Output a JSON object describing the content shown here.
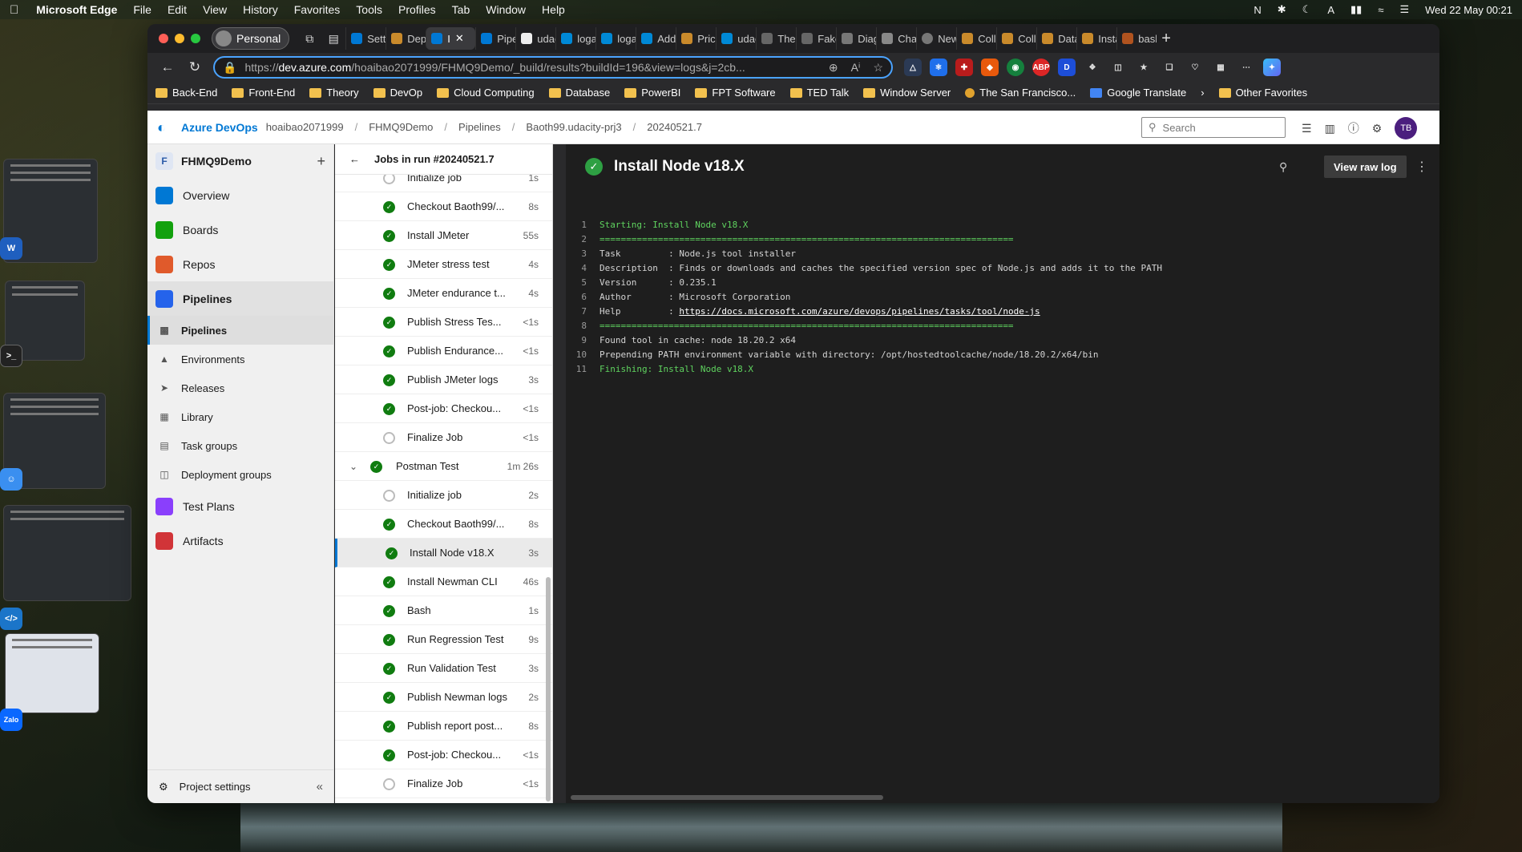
{
  "menubar": {
    "app": "Microsoft Edge",
    "items": [
      "File",
      "Edit",
      "View",
      "History",
      "Favorites",
      "Tools",
      "Profiles",
      "Tab",
      "Window",
      "Help"
    ],
    "datetime": "Wed 22 May  00:21"
  },
  "browser": {
    "profile": "Personal",
    "tabs": [
      "Sett",
      "Dep",
      "I",
      "Pipe",
      "udac",
      "loga",
      "loga",
      "Add",
      "Pric",
      "udac",
      "The",
      "Fake",
      "Diag",
      "Chat",
      "New",
      "Coll",
      "Coll",
      "Data",
      "Insta",
      "bash"
    ],
    "url_prefix": "https://",
    "url_host": "dev.azure.com",
    "url_rest": "/hoaibao2071999/FHMQ9Demo/_build/results?buildId=196&view=logs&j=2cb...",
    "bookmarks": [
      "Back-End",
      "Front-End",
      "Theory",
      "DevOp",
      "Cloud Computing",
      "Database",
      "PowerBI",
      "FPT Software",
      "TED Talk",
      "Window Server",
      "The San Francisco...",
      "Google Translate"
    ],
    "other_favorites": "Other Favorites"
  },
  "header": {
    "brand": "Azure DevOps",
    "crumbs": [
      "hoaibao2071999",
      "FHMQ9Demo",
      "Pipelines",
      "Baoth99.udacity-prj3",
      "20240521.7"
    ],
    "search_placeholder": "Search",
    "avatar": "TB"
  },
  "sidebar": {
    "project": "FHMQ9Demo",
    "items": [
      "Overview",
      "Boards",
      "Repos",
      "Pipelines"
    ],
    "subitems": [
      "Pipelines",
      "Environments",
      "Releases",
      "Library",
      "Task groups",
      "Deployment groups"
    ],
    "items2": [
      "Test Plans",
      "Artifacts"
    ],
    "settings": "Project settings"
  },
  "jobs": {
    "title": "Jobs in run #20240521.7",
    "rows": [
      {
        "name": "Initialize job",
        "dur": "1s",
        "status": "grey"
      },
      {
        "name": "Checkout Baoth99/...",
        "dur": "8s",
        "status": "ok"
      },
      {
        "name": "Install JMeter",
        "dur": "55s",
        "status": "ok"
      },
      {
        "name": "JMeter stress test",
        "dur": "4s",
        "status": "ok"
      },
      {
        "name": "JMeter endurance t...",
        "dur": "4s",
        "status": "ok"
      },
      {
        "name": "Publish Stress Tes...",
        "dur": "<1s",
        "status": "ok"
      },
      {
        "name": "Publish Endurance...",
        "dur": "<1s",
        "status": "ok"
      },
      {
        "name": "Publish JMeter logs",
        "dur": "3s",
        "status": "ok"
      },
      {
        "name": "Post-job: Checkou...",
        "dur": "<1s",
        "status": "ok"
      },
      {
        "name": "Finalize Job",
        "dur": "<1s",
        "status": "grey"
      }
    ],
    "group": {
      "name": "Postman Test",
      "dur": "1m 26s"
    },
    "group_rows": [
      {
        "name": "Initialize job",
        "dur": "2s",
        "status": "grey"
      },
      {
        "name": "Checkout Baoth99/...",
        "dur": "8s",
        "status": "ok"
      },
      {
        "name": "Install Node v18.X",
        "dur": "3s",
        "status": "ok"
      },
      {
        "name": "Install Newman CLI",
        "dur": "46s",
        "status": "ok"
      },
      {
        "name": "Bash",
        "dur": "1s",
        "status": "ok"
      },
      {
        "name": "Run Regression Test",
        "dur": "9s",
        "status": "ok"
      },
      {
        "name": "Run Validation Test",
        "dur": "3s",
        "status": "ok"
      },
      {
        "name": "Publish Newman logs",
        "dur": "2s",
        "status": "ok"
      },
      {
        "name": "Publish report post...",
        "dur": "8s",
        "status": "ok"
      },
      {
        "name": "Post-job: Checkou...",
        "dur": "<1s",
        "status": "ok"
      },
      {
        "name": "Finalize Job",
        "dur": "<1s",
        "status": "grey"
      }
    ]
  },
  "log": {
    "title": "Install Node v18.X",
    "raw_button": "View raw log",
    "lines": [
      {
        "n": "1",
        "t": "Starting: Install Node v18.X",
        "c": "g"
      },
      {
        "n": "2",
        "t": "==============================================================================",
        "c": "g"
      },
      {
        "n": "3",
        "t": "Task         : Node.js tool installer",
        "c": ""
      },
      {
        "n": "4",
        "t": "Description  : Finds or downloads and caches the specified version spec of Node.js and adds it to the PATH",
        "c": ""
      },
      {
        "n": "5",
        "t": "Version      : 0.235.1",
        "c": ""
      },
      {
        "n": "6",
        "t": "Author       : Microsoft Corporation",
        "c": ""
      },
      {
        "n": "7",
        "t": "Help         : ",
        "link": "https://docs.microsoft.com/azure/devops/pipelines/tasks/tool/node-js",
        "c": ""
      },
      {
        "n": "8",
        "t": "==============================================================================",
        "c": "g"
      },
      {
        "n": "9",
        "t": "Found tool in cache: node 18.20.2 x64",
        "c": ""
      },
      {
        "n": "10",
        "t": "Prepending PATH environment variable with directory: /opt/hostedtoolcache/node/18.20.2/x64/bin",
        "c": ""
      },
      {
        "n": "11",
        "t": "Finishing: Install Node v18.X",
        "c": "g"
      }
    ]
  }
}
